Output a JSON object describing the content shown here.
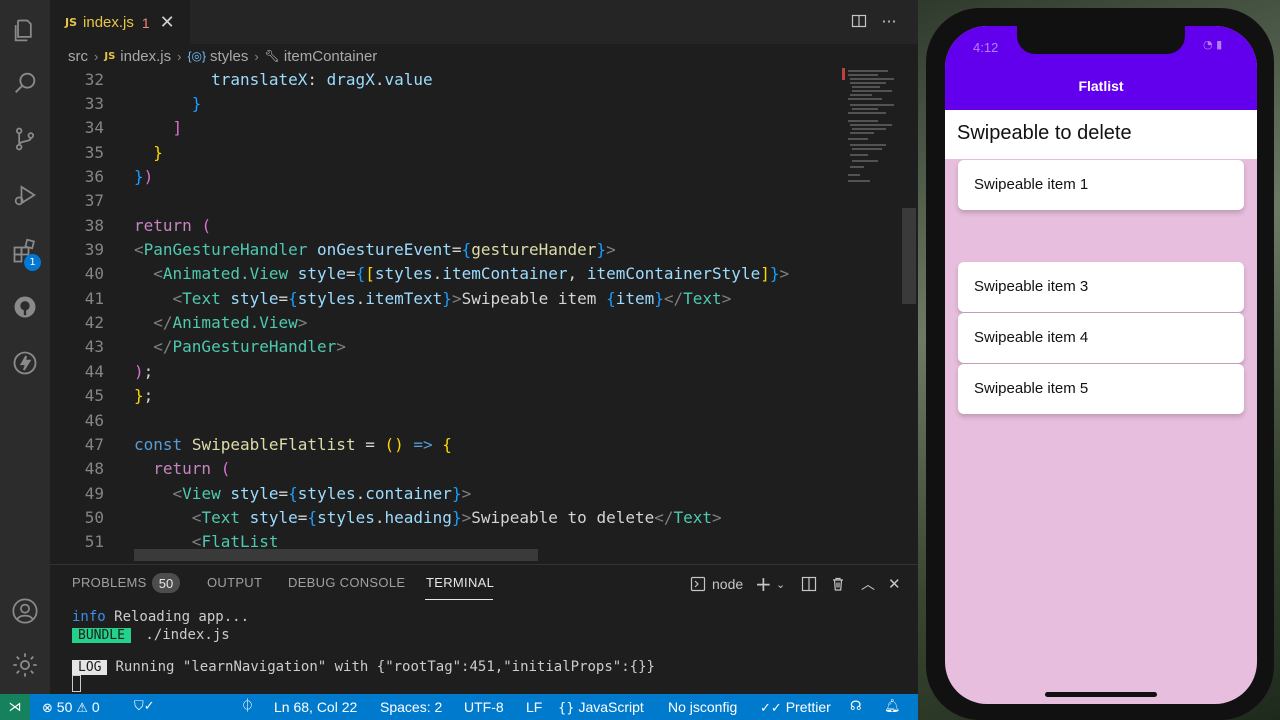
{
  "editor": {
    "tab": {
      "badge": "JS",
      "name": "index.js",
      "errors": "1",
      "close": "✕"
    },
    "breadcrumb": {
      "folder": "src",
      "js_badge": "JS",
      "file": "index.js",
      "symbol1": "styles",
      "symbol2": "itemContainer"
    },
    "line_numbers": [
      "32",
      "33",
      "34",
      "35",
      "36",
      "37",
      "38",
      "39",
      "40",
      "41",
      "42",
      "43",
      "44",
      "45",
      "46",
      "47",
      "48",
      "49",
      "50",
      "51"
    ]
  },
  "panel": {
    "tabs": [
      "PROBLEMS",
      "OUTPUT",
      "DEBUG CONSOLE",
      "TERMINAL"
    ],
    "problems_count": "50",
    "terminal_shell": "node",
    "terminal_lines": {
      "info_label": "info",
      "info_text": " Reloading app...",
      "bundle_label": "BUNDLE",
      "bundle_text": " ./index.js",
      "log_label": "LOG",
      "log_text": "Running \"learnNavigation\" with {\"rootTag\":451,\"initialProps\":{}}"
    }
  },
  "statusbar": {
    "errors": "50",
    "warnings": "0",
    "position": "Ln 68, Col 22",
    "spaces": "Spaces: 2",
    "encoding": "UTF-8",
    "eol": "LF",
    "language": "JavaScript",
    "jsconfig": "No jsconfig",
    "formatter": "Prettier"
  },
  "simulator": {
    "status_time": "4:12",
    "header_title": "Flatlist",
    "heading": "Swipeable to delete",
    "items": [
      "Swipeable item 1",
      "Swipeable item 3",
      "Swipeable item 4",
      "Swipeable item 5"
    ]
  },
  "colors": {
    "accent_status_bar": "#007acc",
    "app_header": "#6200ee",
    "app_background": "#e7bedd"
  }
}
